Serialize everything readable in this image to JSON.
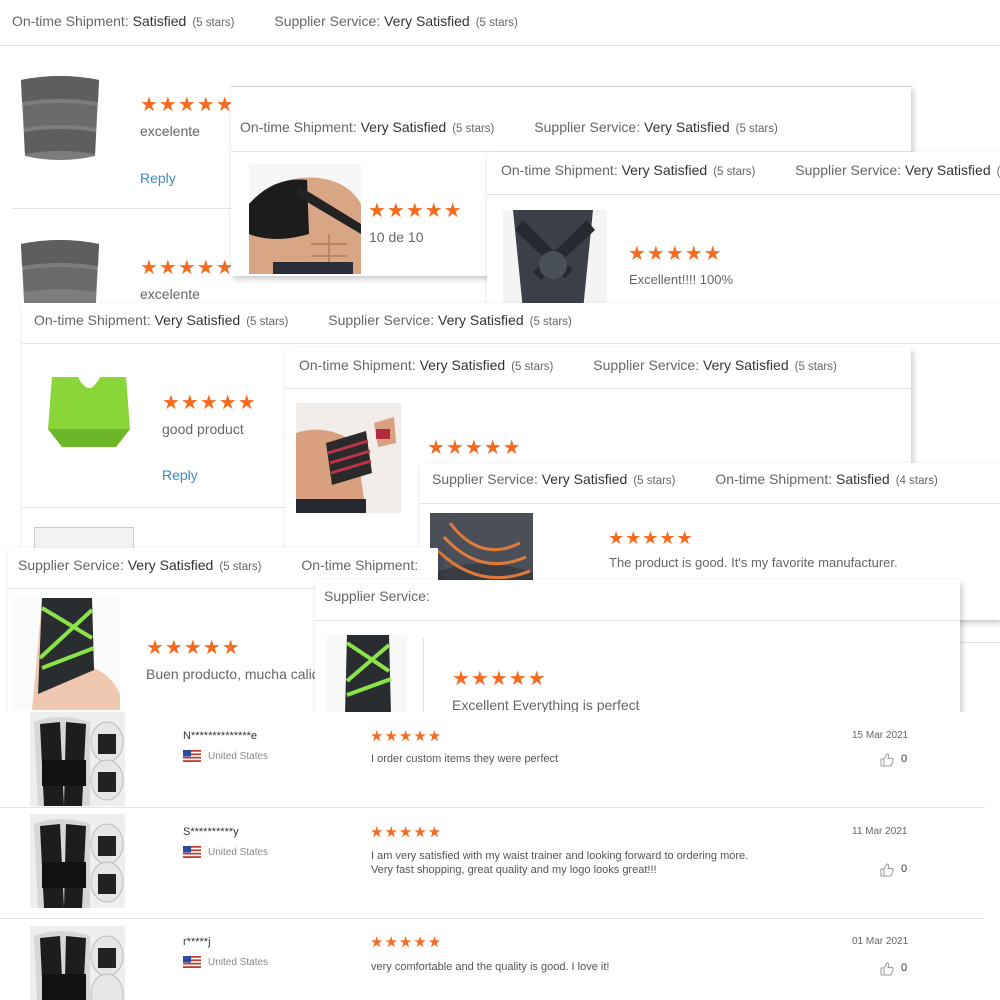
{
  "colors": {
    "star": "#f56b1f",
    "link": "#3b8bc4",
    "divider": "#e3e3e3"
  },
  "labels": {
    "ontime": "On-time Shipment:",
    "supplier": "Supplier Service:",
    "reply": "Reply"
  },
  "ratings": {
    "satisfied": "Satisfied",
    "very_satisfied": "Very Satisfied",
    "five": "(5 stars)",
    "four": "(4 stars)"
  },
  "stars_5": "★★★★★",
  "reviews": {
    "waist1": "excelente",
    "shoulder": "10 de 10",
    "knee": "Excellent!!!! 100%",
    "cushion": "good product",
    "elbow": "The product is good. It's my favorite manufacturer.",
    "ankle1": "Buen producto, mucha calid",
    "ankle2": "Excellent Everything is perfect"
  },
  "list": [
    {
      "name": "N**************e",
      "country": "United States",
      "text": [
        "I order custom items they were perfect"
      ],
      "date": "15 Mar 2021",
      "likes": "0"
    },
    {
      "name": "S**********y",
      "country": "United States",
      "text": [
        "I am very satisfied with my waist trainer and looking forward to ordering more.",
        "Very fast shopping, great quality  and my logo looks great!!!"
      ],
      "date": "11 Mar 2021",
      "likes": "0"
    },
    {
      "name": "r*****j",
      "country": "United States",
      "text": [
        "very comfortable and the quality is good. I love it!"
      ],
      "date": "01 Mar 2021",
      "likes": "0"
    }
  ],
  "icons": [
    "waist-trainer-image",
    "shoulder-brace-image",
    "knee-sleeve-image",
    "green-cushion-image",
    "wrist-wrap-image",
    "elbow-sleeve-image",
    "ankle-brace-image",
    "posture-corrector-image",
    "us-flag-icon",
    "thumbs-up-icon"
  ]
}
